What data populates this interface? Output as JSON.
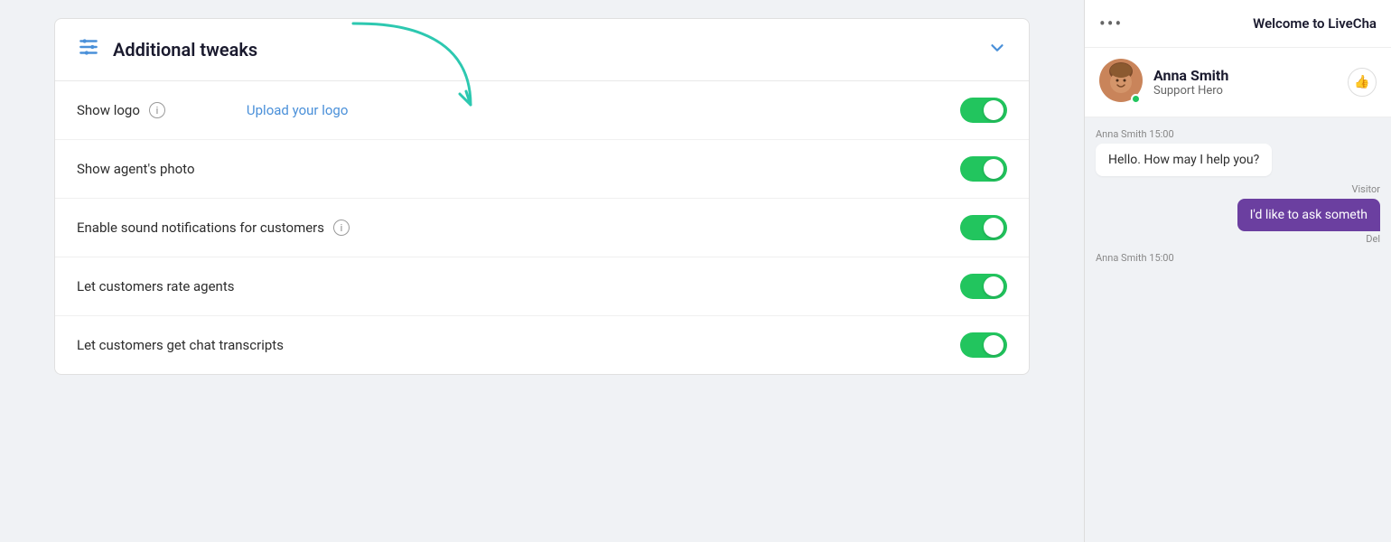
{
  "card": {
    "title": "Additional tweaks",
    "chevron": "∨"
  },
  "rows": [
    {
      "label": "Show logo",
      "hasInfo": true,
      "uploadLink": "Upload your logo",
      "toggleOn": true
    },
    {
      "label": "Show agent's photo",
      "hasInfo": false,
      "uploadLink": null,
      "toggleOn": true
    },
    {
      "label": "Enable sound notifications for customers",
      "hasInfo": true,
      "uploadLink": null,
      "toggleOn": true
    },
    {
      "label": "Let customers rate agents",
      "hasInfo": false,
      "uploadLink": null,
      "toggleOn": true
    },
    {
      "label": "Let customers get chat transcripts",
      "hasInfo": false,
      "uploadLink": null,
      "toggleOn": true
    }
  ],
  "chat": {
    "header_dots": "•••",
    "header_title": "Welcome to LiveCha",
    "agent": {
      "name": "Anna Smith",
      "role": "Support Hero"
    },
    "messages": [
      {
        "sender": "Anna Smith",
        "time": "15:00",
        "text": "Hello. How may I help you?",
        "type": "agent"
      },
      {
        "sender": "Visitor",
        "time": "",
        "text": "I'd like to ask someth",
        "type": "visitor"
      },
      {
        "sender": "Anna Smith",
        "time": "15:00",
        "text": "",
        "type": "agent"
      }
    ],
    "del_label": "Del"
  }
}
